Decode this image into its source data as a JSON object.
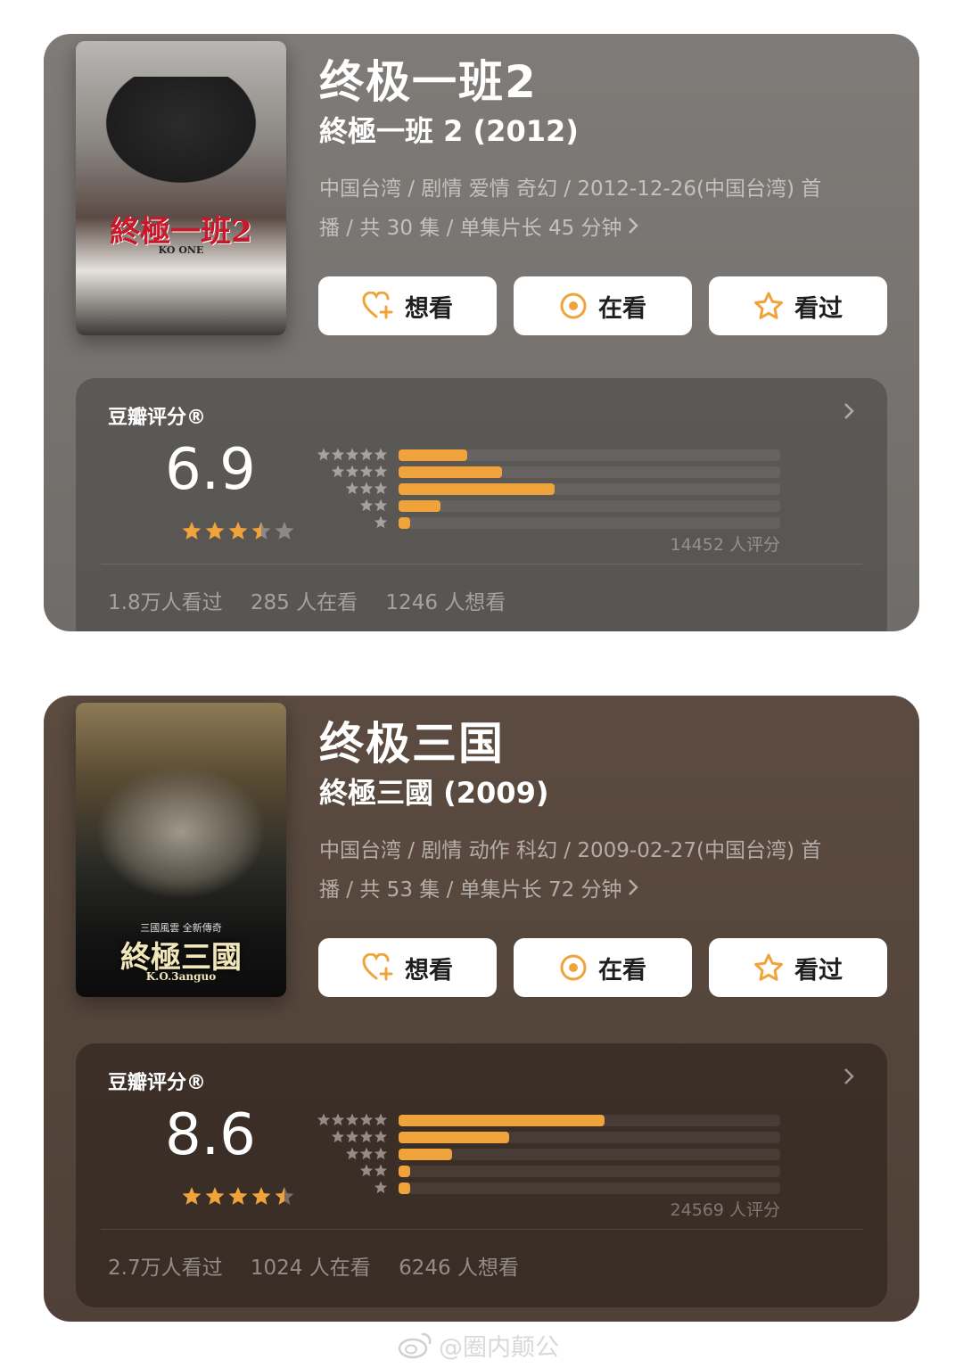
{
  "cards": [
    {
      "title": "终极一班2",
      "subtitle": "終極一班 2 (2012)",
      "meta_line1": "中国台湾 / 剧情 爱情 奇幻 / 2012-12-26(中国台湾) 首",
      "meta_line2": "播 / 共 30 集 / 单集片长 45 分钟",
      "poster_title": "終極一班2",
      "poster_subtitle": "KO ONE",
      "buttons": {
        "want": "想看",
        "watching": "在看",
        "watched": "看过"
      },
      "rating_label": "豆瓣评分®",
      "score": "6.9",
      "stars": 3.5,
      "distribution": [
        0.18,
        0.27,
        0.41,
        0.11,
        0.03
      ],
      "rating_count": "14452 人评分",
      "stats": {
        "watched": "1.8万人看过",
        "watching": "285 人在看",
        "want": "1246 人想看"
      }
    },
    {
      "title": "终极三国",
      "subtitle": "終極三國 (2009)",
      "meta_line1": "中国台湾 / 剧情 动作 科幻 / 2009-02-27(中国台湾) 首",
      "meta_line2": "播 / 共 53 集 / 单集片长 72 分钟",
      "poster_title": "終極三國",
      "poster_subtitle": "K.O.3anguo",
      "poster_tag": "三國風雲 全新傳奇",
      "buttons": {
        "want": "想看",
        "watching": "在看",
        "watched": "看过"
      },
      "rating_label": "豆瓣评分®",
      "score": "8.6",
      "stars": 4.5,
      "distribution": [
        0.54,
        0.29,
        0.14,
        0.03,
        0.03
      ],
      "rating_count": "24569 人评分",
      "stats": {
        "watched": "2.7万人看过",
        "watching": "1024 人在看",
        "want": "6246 人想看"
      }
    }
  ],
  "watermark": "@圈内颠公",
  "colors": {
    "accent": "#f0a33b",
    "card1_bg": "#7a7673",
    "card2_bg": "#574639"
  }
}
